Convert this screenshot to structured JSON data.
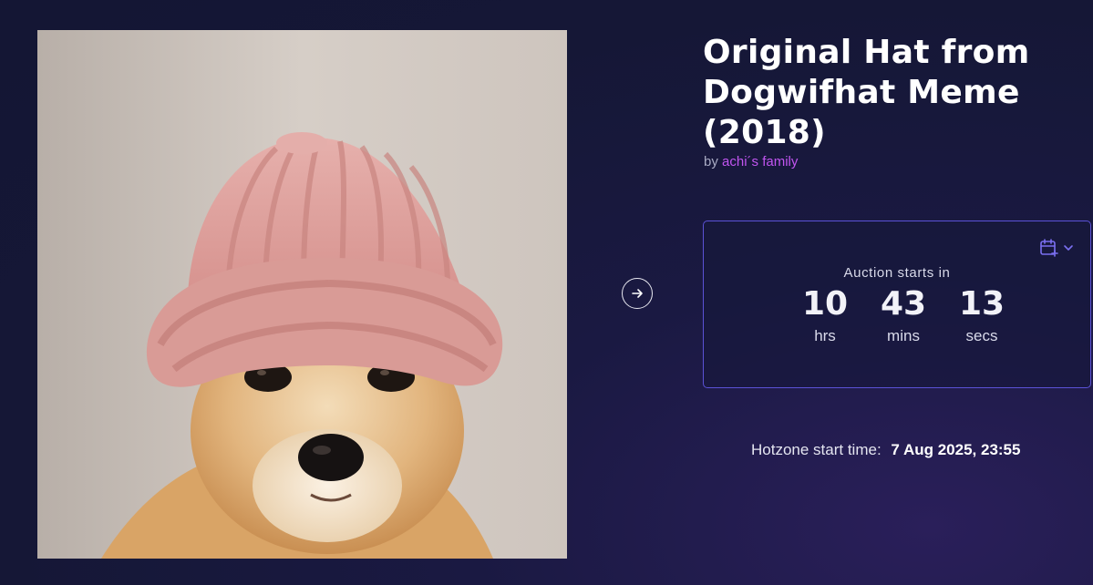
{
  "item": {
    "title": "Original Hat from Dogwifhat Meme (2018)",
    "by_prefix": "by",
    "artist": "achi´s family",
    "image_alt": "dog wearing pink knit hat"
  },
  "auction": {
    "label": "Auction starts in",
    "countdown": [
      {
        "value": "10",
        "unit": "hrs"
      },
      {
        "value": "43",
        "unit": "mins"
      },
      {
        "value": "13",
        "unit": "secs"
      }
    ],
    "calendar_icon": "calendar-plus-icon",
    "dropdown_icon": "chevron-down-icon"
  },
  "hotzone": {
    "label": "Hotzone start time:",
    "value": "7 Aug 2025, 23:55"
  },
  "navigation": {
    "next_icon": "arrow-right-circle-icon"
  },
  "colors": {
    "background": "#151736",
    "accent_border": "#5b52d6",
    "artist_link": "#c155f0",
    "calendar_icon": "#7a6ff0"
  }
}
